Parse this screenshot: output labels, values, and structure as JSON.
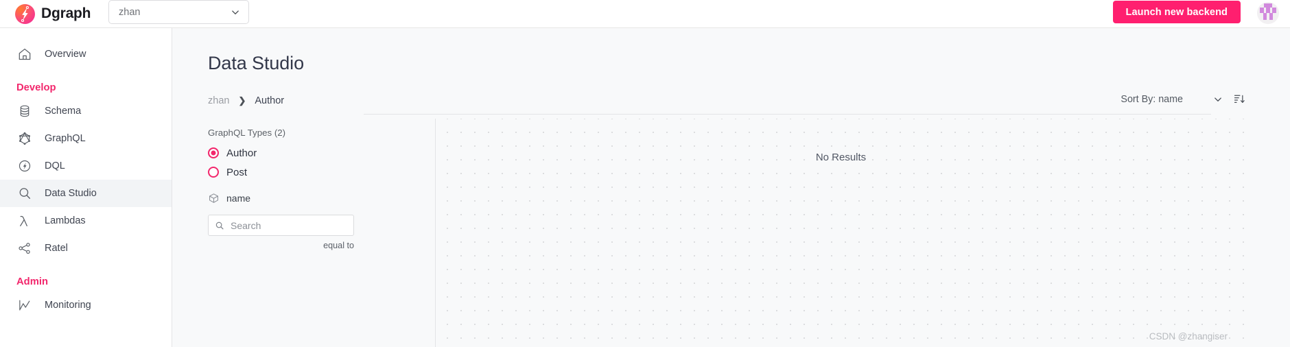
{
  "header": {
    "brand_name": "Dgraph",
    "logo_icon": "dgraph-bolt-logo",
    "namespace_select": {
      "value": "zhan",
      "icon": "chevron-down-icon"
    },
    "launch_button": "Launch new backend",
    "avatar_icon": "user-identicon-avatar"
  },
  "sidebar": {
    "items": [
      {
        "label": "Overview",
        "icon": "home-icon",
        "active": false
      },
      {
        "label": "Schema",
        "icon": "database-icon",
        "active": false
      },
      {
        "label": "GraphQL",
        "icon": "graphql-icon",
        "active": false
      },
      {
        "label": "DQL",
        "icon": "dql-bolt-icon",
        "active": false
      },
      {
        "label": "Data Studio",
        "icon": "magnifier-icon",
        "active": true
      },
      {
        "label": "Lambdas",
        "icon": "lambda-icon",
        "active": false
      },
      {
        "label": "Ratel",
        "icon": "node-graph-icon",
        "active": false
      },
      {
        "label": "Monitoring",
        "icon": "line-chart-icon",
        "active": false
      }
    ],
    "groups": {
      "develop": "Develop",
      "admin": "Admin"
    }
  },
  "main": {
    "page_title": "Data Studio",
    "breadcrumb": {
      "namespace": "zhan",
      "separator": "❯",
      "current": "Author"
    },
    "sort": {
      "label": "Sort By: name",
      "chevron_icon": "chevron-down-icon",
      "direction_icon": "sort-descending-icon"
    },
    "filter_panel": {
      "types_heading": "GraphQL Types (2)",
      "types": [
        {
          "label": "Author",
          "selected": true
        },
        {
          "label": "Post",
          "selected": false
        }
      ],
      "field": {
        "label": "name",
        "icon": "cube-icon"
      },
      "search": {
        "value": "",
        "placeholder": "Search",
        "icon": "search-icon"
      },
      "operator": "equal to"
    },
    "canvas": {
      "empty_message": "No Results"
    },
    "watermark": "CSDN @zhangiser"
  },
  "colors": {
    "accent_pink": "#ff1f6f",
    "group_pink": "#f2276c",
    "main_bg": "#f8f9fa",
    "border": "#e3e4e6",
    "avatar_purple": "#d189dd"
  }
}
